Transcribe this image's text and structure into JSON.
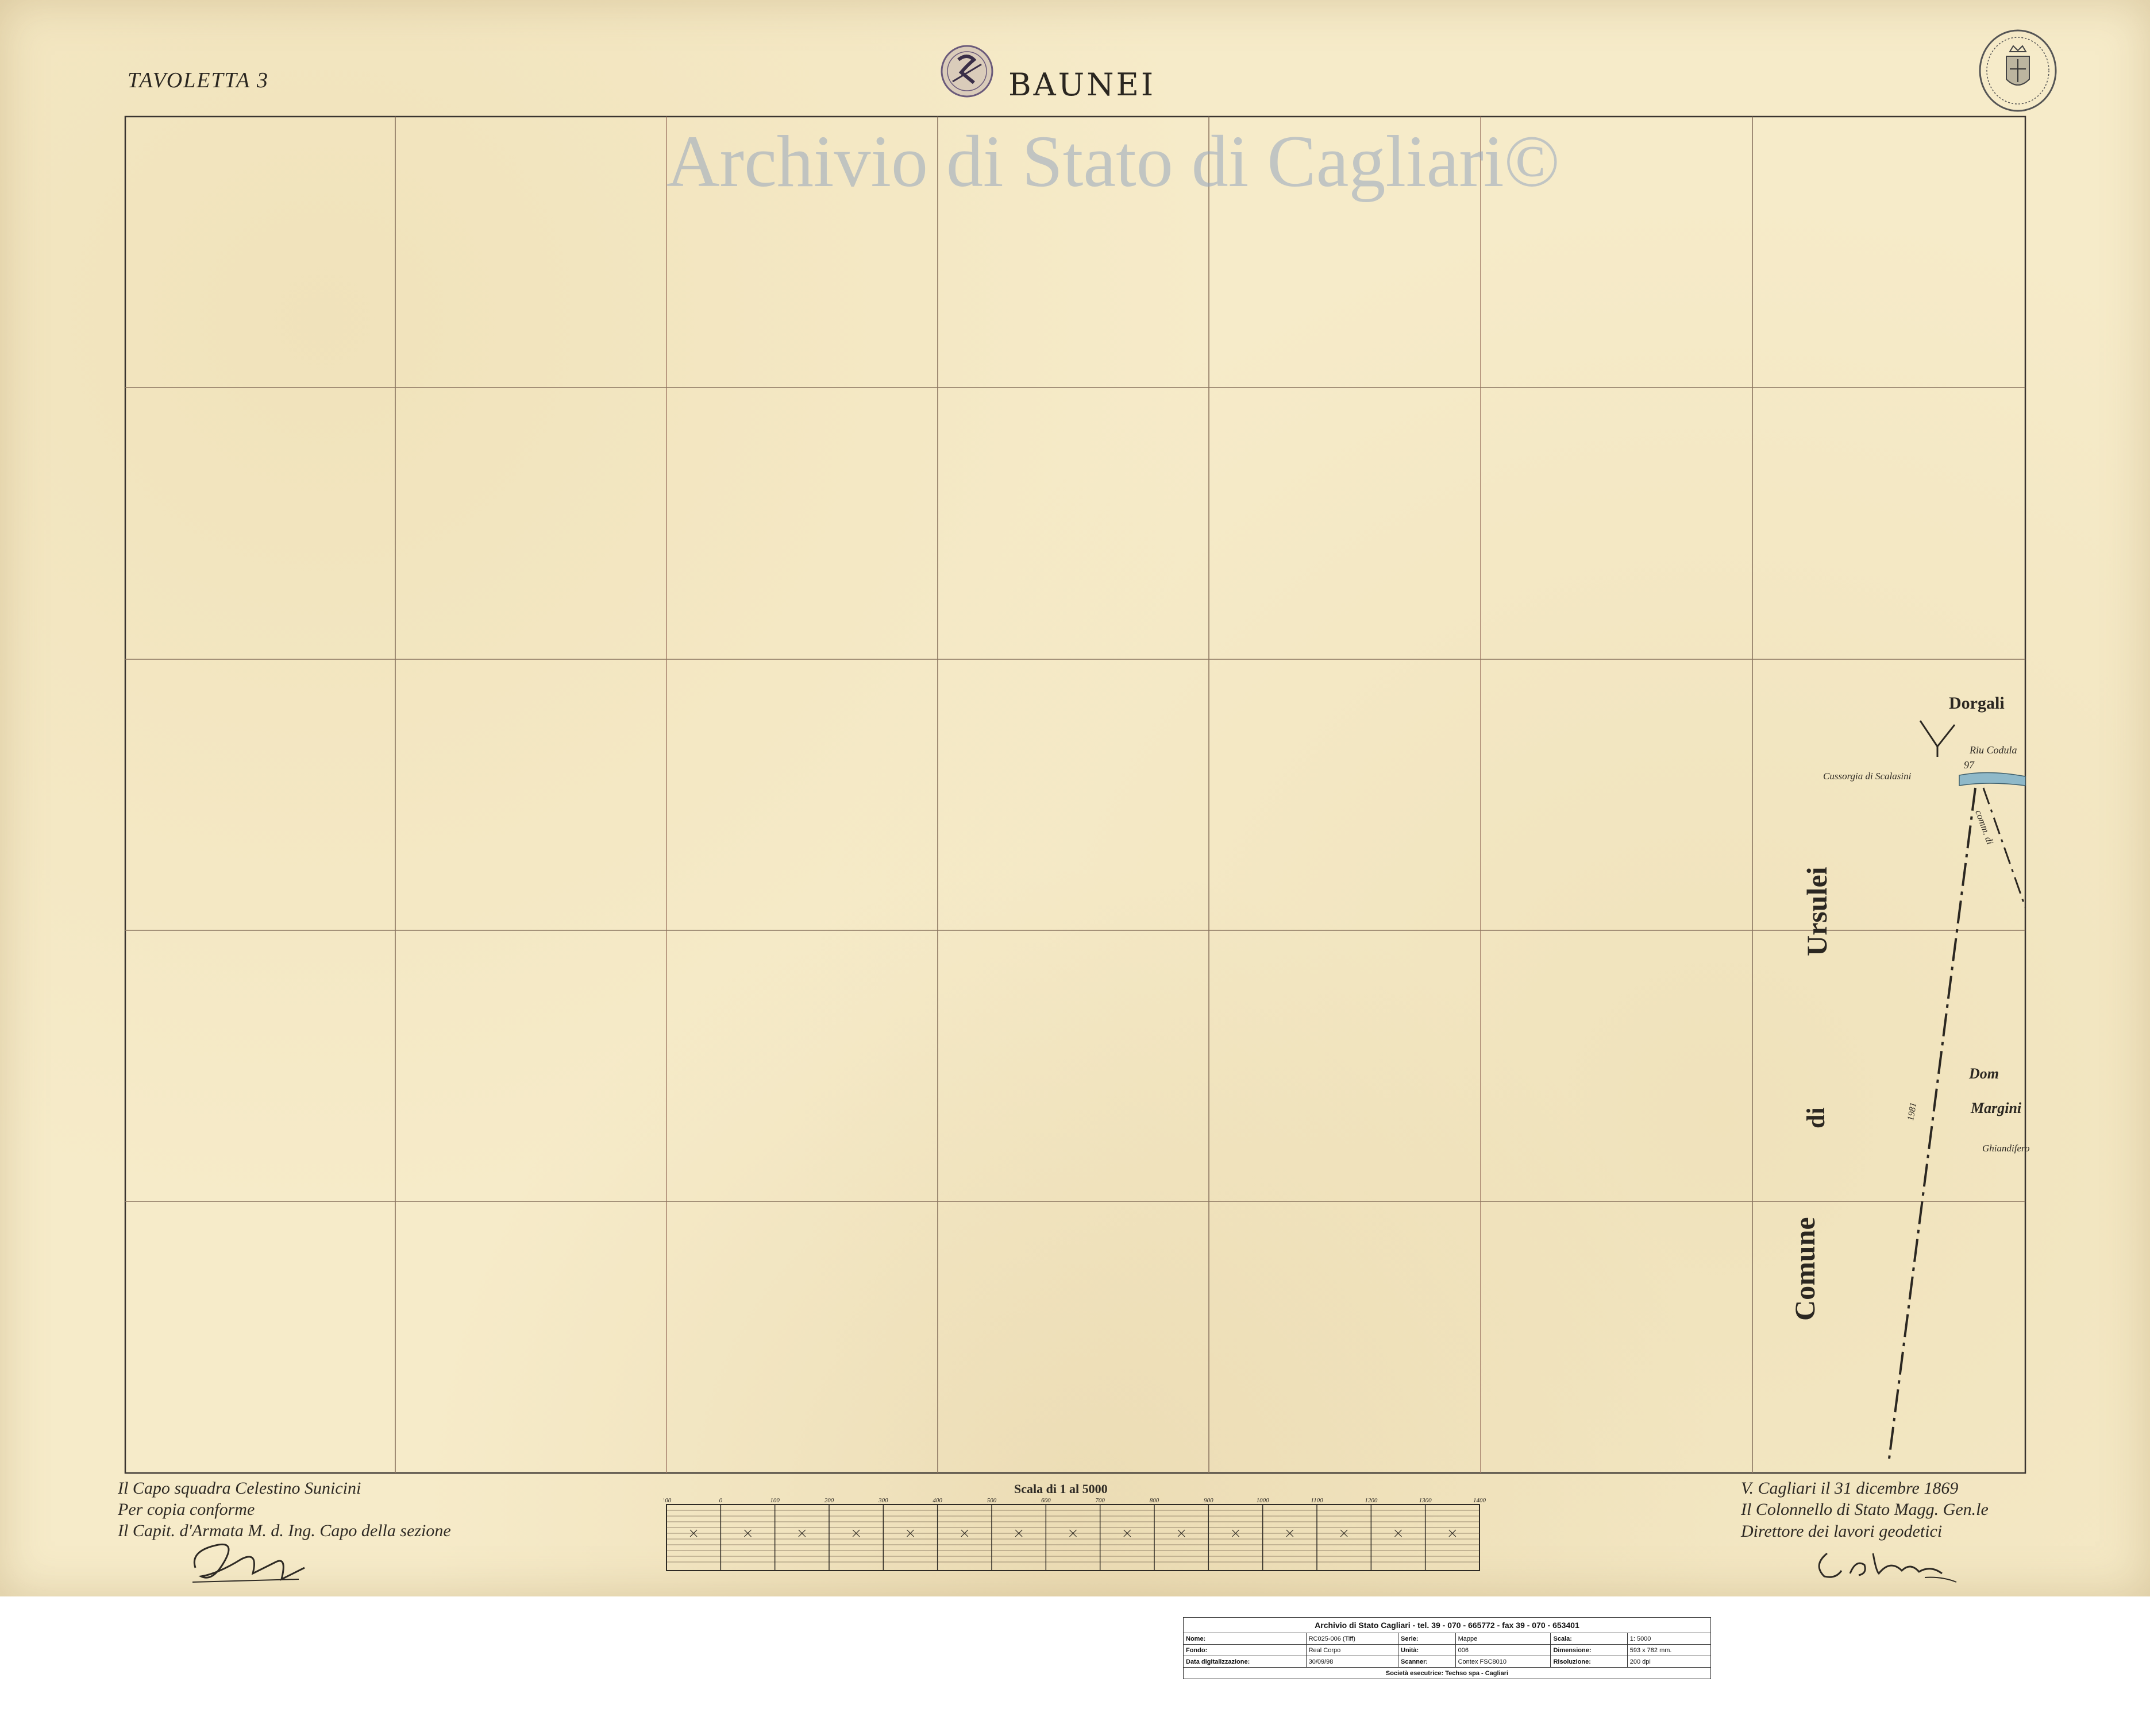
{
  "map": {
    "sheet_label": "TAVOLETTA 3",
    "title": "BAUNEI",
    "watermark": "Archivio di Stato di Cagliari©",
    "labels": {
      "dorgali": "Dorgali",
      "comune": "Comune",
      "di": "di",
      "ursulei": "Ursulei",
      "dom": "Dom",
      "margini": "Margini",
      "ghiandifero": "Ghiandifero",
      "cussorgia": "Cussorgia di Scalasini",
      "riu": "Riu Codula",
      "comm": "comm. di",
      "point_num": "97",
      "line_num": "1981"
    },
    "notes_left": [
      "Il Capo squadra Celestino Sunicini",
      "Per copia conforme",
      "Il Capit. d'Armata M. d. Ing. Capo della sezione"
    ],
    "notes_right": [
      "V. Cagliari il 31 dicembre 1869",
      "Il Colonnello di Stato Magg. Gen.le",
      "Direttore dei lavori geodetici"
    ],
    "scale_title": "Scala di 1 al 5000",
    "scale_ticks": [
      "100",
      "0",
      "100",
      "200",
      "300",
      "400",
      "500",
      "600",
      "700",
      "800",
      "900",
      "1000",
      "1100",
      "1200",
      "1300",
      "1400"
    ]
  },
  "info_table": {
    "title": "Archivio di Stato Cagliari - tel. 39 - 070 - 665772 - fax 39 - 070 - 653401",
    "rows": [
      [
        "Nome:",
        "RC025-006 (Tiff)",
        "Serie:",
        "Mappe",
        "Scala:",
        "1: 5000"
      ],
      [
        "Fondo:",
        "Real Corpo",
        "Unità:",
        "006",
        "Dimensione:",
        "593 x 782 mm."
      ],
      [
        "Data digitalizzazione:",
        "30/09/98",
        "Scanner:",
        "Contex FSC8010",
        "Risoluzione:",
        "200 dpi"
      ]
    ],
    "footer": "Società esecutrice: Techso spa - Cagliari"
  }
}
